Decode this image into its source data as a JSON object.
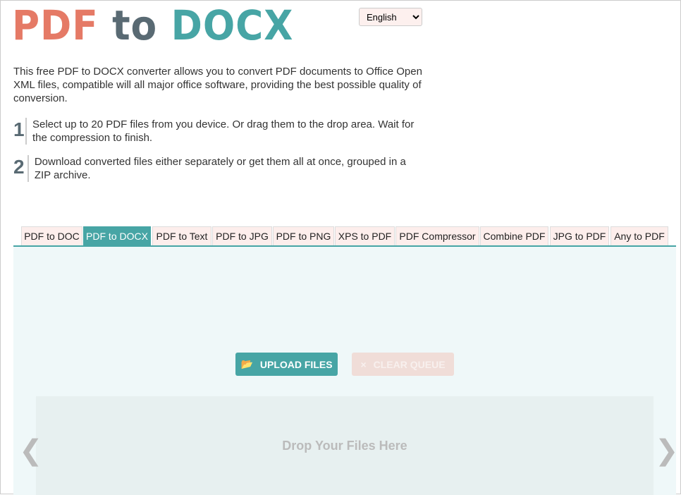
{
  "logo": {
    "part1": "PDF",
    "part2": "to",
    "part3": "DOCX"
  },
  "language": {
    "selected": "English"
  },
  "intro": "This free PDF to DOCX converter allows you to convert PDF documents to Office Open XML files, compatible will all major office software, providing the best possible quality of conversion.",
  "steps": [
    {
      "num": "1",
      "text": "Select up to 20 PDF files from you device. Or drag them to the drop area. Wait for the compression to finish."
    },
    {
      "num": "2",
      "text": "Download converted files either separately or get them all at once, grouped in a ZIP archive."
    }
  ],
  "tabs": [
    "PDF to DOC",
    "PDF to DOCX",
    "PDF to Text",
    "PDF to JPG",
    "PDF to PNG",
    "XPS to PDF",
    "PDF Compressor",
    "Combine PDF",
    "JPG to PDF",
    "Any to PDF"
  ],
  "active_tab": "PDF to DOCX",
  "buttons": {
    "upload": "UPLOAD FILES",
    "clear": "CLEAR QUEUE"
  },
  "dropzone": "Drop Your Files Here",
  "colors": {
    "coral": "#e57a66",
    "slate": "#596a73",
    "teal": "#47a5a5"
  }
}
